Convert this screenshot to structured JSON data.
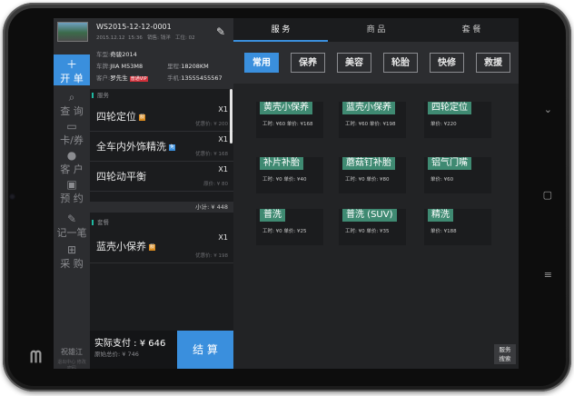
{
  "device": {
    "brand_logo": "mi-logo"
  },
  "rail": {
    "items": [
      {
        "label": "开 单",
        "icon": "plus-icon",
        "active": true
      },
      {
        "label": "查 询",
        "icon": "search-icon",
        "active": false
      },
      {
        "label": "卡/券",
        "icon": "card-icon",
        "active": false
      },
      {
        "label": "客 户",
        "icon": "user-icon",
        "active": false
      },
      {
        "label": "预 约",
        "icon": "calendar-icon",
        "active": false
      },
      {
        "label": "记一笔",
        "icon": "pen-icon",
        "active": false
      },
      {
        "label": "采 购",
        "icon": "cart-icon",
        "active": false
      }
    ],
    "operator": "祝雄江",
    "footer_note": "退出中心 修改密码"
  },
  "order": {
    "number": "WS2015-12-12-0001",
    "date": "2015.12.12",
    "time": "15:36",
    "sales_label": "销售:",
    "sales": "钱洋",
    "station_label": "工位:",
    "station": "02",
    "car_model_label": "车型:",
    "car_model": "奇骏2014",
    "plate_label": "车牌:",
    "plate": "JIIA M53M8",
    "mileage_label": "里程:",
    "mileage": "18208KM",
    "customer_label": "客户:",
    "customer": "罗先生",
    "vip": "普通VIP",
    "phone_label": "手机:",
    "phone": "13555455567",
    "service_section": "服务",
    "package_section": "套餐",
    "items": [
      {
        "name": "四轮定位",
        "badge": "服",
        "qty": "X1",
        "price": "优惠价: ¥ 200"
      },
      {
        "name": "全车内外饰精洗",
        "badge": "免",
        "qty": "X1",
        "price": "优惠价: ¥ 168"
      },
      {
        "name": "四轮动平衡",
        "badge": "",
        "qty": "X1",
        "price": "原价: ¥ 80"
      }
    ],
    "subtotal": "小计: ¥ 448",
    "package_items": [
      {
        "name": "蓝壳小保养",
        "badge": "服",
        "qty": "X1",
        "price": "优惠价: ¥ 198"
      }
    ],
    "pay_label": "实际支付 : ¥ 646",
    "orig_total": "原始总价: ¥ 746",
    "checkout": "结 算"
  },
  "main": {
    "tabs": [
      "服 务",
      "商 品",
      "套 餐"
    ],
    "chips": [
      "常用",
      "保养",
      "美容",
      "轮胎",
      "快修",
      "救援"
    ],
    "cards": [
      {
        "title": "黄壳小保养",
        "detail": "工时: ¥60  单价: ¥168"
      },
      {
        "title": "蓝壳小保养",
        "detail": "工时: ¥60  单价: ¥198"
      },
      {
        "title": "四轮定位",
        "detail": "单价: ¥220"
      },
      {
        "title": "补片补胎",
        "detail": "工时: ¥0  单价: ¥40"
      },
      {
        "title": "蘑菇钉补胎",
        "detail": "工时: ¥0  单价: ¥80"
      },
      {
        "title": "铝气门嘴",
        "detail": "单价: ¥60"
      },
      {
        "title": "普洗",
        "detail": "工时: ¥0  单价: ¥25"
      },
      {
        "title": "普洗 (SUV)",
        "detail": "工时: ¥0  单价: ¥35"
      },
      {
        "title": "精洗",
        "detail": "单价: ¥188"
      }
    ],
    "search_line1": "服务",
    "search_line2": "搜索"
  },
  "colors": {
    "accent": "#3a8fdd",
    "card_title": "#3f8a72",
    "vip": "#d0303a"
  }
}
